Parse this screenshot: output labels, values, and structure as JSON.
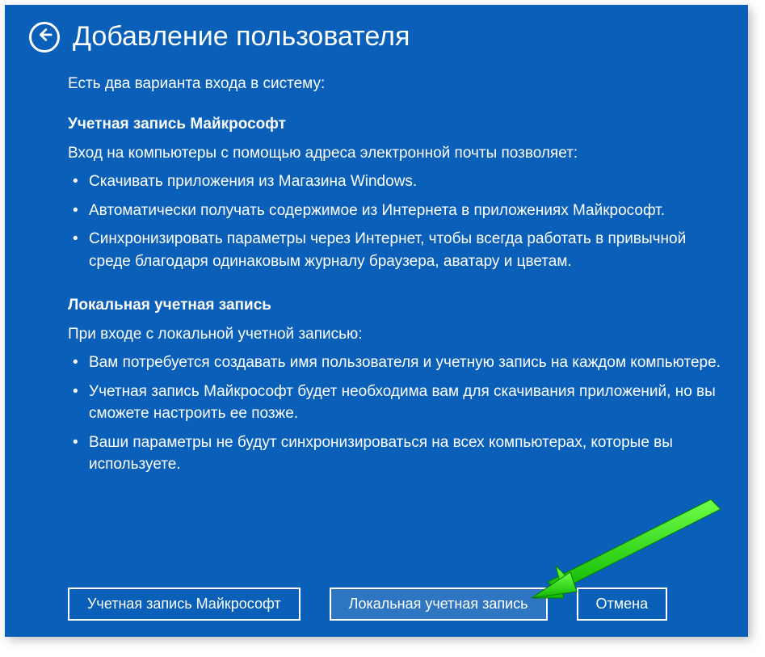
{
  "header": {
    "title": "Добавление пользователя"
  },
  "intro": "Есть два варианта входа в систему:",
  "microsoft": {
    "heading": "Учетная запись Майкрософт",
    "lead": "Вход на компьютеры с помощью адреса электронной почты позволяет:",
    "bullets": [
      "Скачивать приложения из Магазина Windows.",
      "Автоматически получать содержимое из Интернета в приложениях Майкрософт.",
      "Синхронизировать параметры через Интернет, чтобы всегда работать в привычной среде благодаря одинаковым журналу браузера, аватару и цветам."
    ]
  },
  "local": {
    "heading": "Локальная учетная запись",
    "lead": "При входе с локальной учетной записью:",
    "bullets": [
      "Вам потребуется создавать имя пользователя и учетную запись на каждом компьютере.",
      "Учетная запись Майкрософт будет необходима вам для скачивания приложений, но вы сможете настроить ее позже.",
      "Ваши параметры не будут синхронизироваться на всех компьютерах, которые вы используете."
    ]
  },
  "buttons": {
    "microsoft": "Учетная запись Майкрософт",
    "local": "Локальная учетная запись",
    "cancel": "Отмена"
  }
}
